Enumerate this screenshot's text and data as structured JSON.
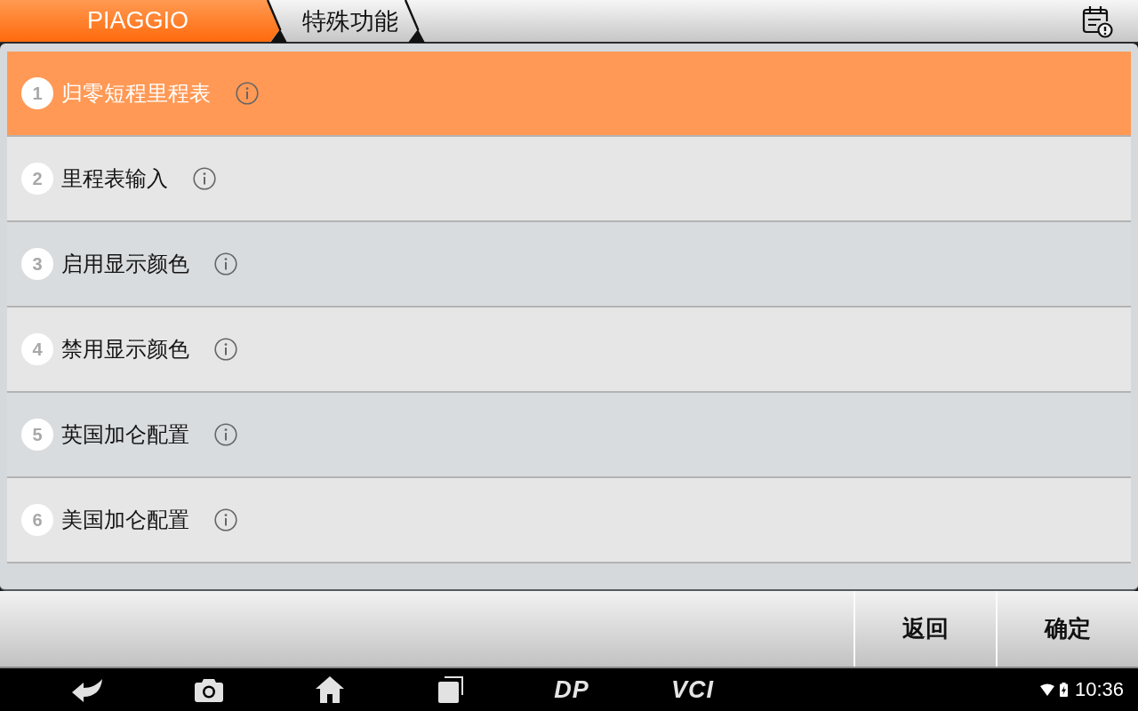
{
  "breadcrumb": [
    {
      "label": "PIAGGIO",
      "selected": true
    },
    {
      "label": "特殊功能",
      "selected": false
    }
  ],
  "functions": [
    {
      "number": "1",
      "label": "归零短程里程表",
      "selected": true
    },
    {
      "number": "2",
      "label": "里程表输入",
      "selected": false
    },
    {
      "number": "3",
      "label": "启用显示颜色",
      "selected": false
    },
    {
      "number": "4",
      "label": "禁用显示颜色",
      "selected": false
    },
    {
      "number": "5",
      "label": "英国加仑配置",
      "selected": false
    },
    {
      "number": "6",
      "label": "美国加仑配置",
      "selected": false
    }
  ],
  "buttons": [
    "返回",
    "确定"
  ],
  "nav_bar": {
    "shortcuts": [
      "DP",
      "VCI"
    ]
  },
  "status_bar": {
    "time": "10:36"
  }
}
